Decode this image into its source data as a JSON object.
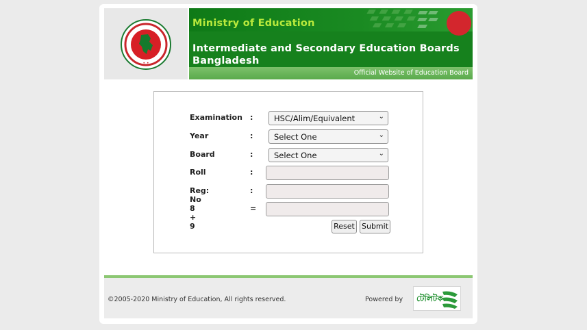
{
  "header": {
    "ministry": "Ministry of Education",
    "boards_line1": "Intermediate and Secondary Education Boards",
    "boards_line2": "Bangladesh",
    "official": "Official Website of Education Board"
  },
  "form": {
    "rows": [
      {
        "label": "Examination",
        "sep": ":",
        "type": "select",
        "value": "HSC/Alim/Equivalent"
      },
      {
        "label": "Year",
        "sep": ":",
        "type": "select",
        "value": "Select One"
      },
      {
        "label": "Board",
        "sep": ":",
        "type": "select",
        "value": "Select One"
      },
      {
        "label": "Roll",
        "sep": ":",
        "type": "input",
        "value": ""
      },
      {
        "label": "Reg: No",
        "sep": ":",
        "type": "input",
        "value": ""
      },
      {
        "label": "8 + 9",
        "sep": "=",
        "type": "input",
        "value": ""
      }
    ],
    "reset_label": "Reset",
    "submit_label": "Submit"
  },
  "footer": {
    "copyright": "©2005-2020 Ministry of Education, All rights reserved.",
    "powered_by": "Powered by",
    "sponsor_logo_text": "টেলিটক"
  },
  "colors": {
    "banner_green": "#16811d",
    "ministry_text": "#b9ea3c",
    "footer_line": "#8cc773"
  }
}
